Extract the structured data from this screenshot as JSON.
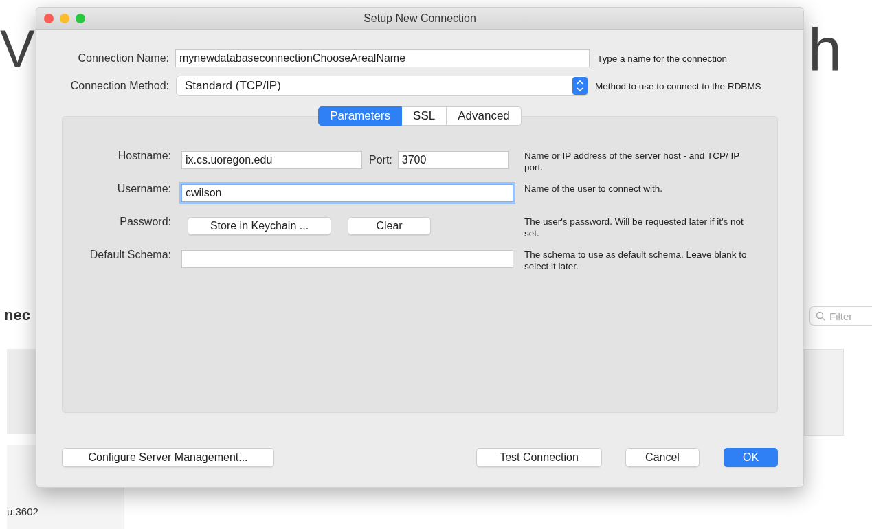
{
  "background": {
    "heading_left": "V",
    "heading_right": "h",
    "section": "nec",
    "filter": {
      "placeholder": "Filter"
    },
    "tile_text": "u:3602"
  },
  "window": {
    "title": "Setup New Connection"
  },
  "connection_name": {
    "label": "Connection Name:",
    "value": "mynewdatabaseconnectionChooseArealName",
    "hint": "Type a name for the connection"
  },
  "connection_method": {
    "label": "Connection Method:",
    "value": "Standard (TCP/IP)",
    "hint": "Method to use to connect to the RDBMS"
  },
  "tabs": [
    {
      "label": "Parameters",
      "selected": true
    },
    {
      "label": "SSL",
      "selected": false
    },
    {
      "label": "Advanced",
      "selected": false
    }
  ],
  "parameters": {
    "hostname": {
      "label": "Hostname:",
      "value": "ix.cs.uoregon.edu"
    },
    "port": {
      "label": "Port:",
      "value": "3700"
    },
    "host_hint": "Name or IP address of the server host - and TCP/ IP port.",
    "username": {
      "label": "Username:",
      "value": "cwilson",
      "focused": true,
      "hint": "Name of the user to connect with."
    },
    "password": {
      "label": "Password:",
      "buttons": [
        "Store in Keychain ...",
        "Clear"
      ],
      "hint": "The user's password. Will be requested later if it's not set."
    },
    "default_schema": {
      "label": "Default Schema:",
      "hint": "The schema to use as default schema. Leave blank to select it later."
    }
  },
  "footer": {
    "left_buttons": [
      {
        "label": "Configure Server Management...",
        "default": false
      }
    ],
    "right_buttons": [
      {
        "label": "Test Connection",
        "default": false
      },
      {
        "label": "Cancel",
        "default": false
      },
      {
        "label": "OK",
        "default": true
      }
    ]
  }
}
